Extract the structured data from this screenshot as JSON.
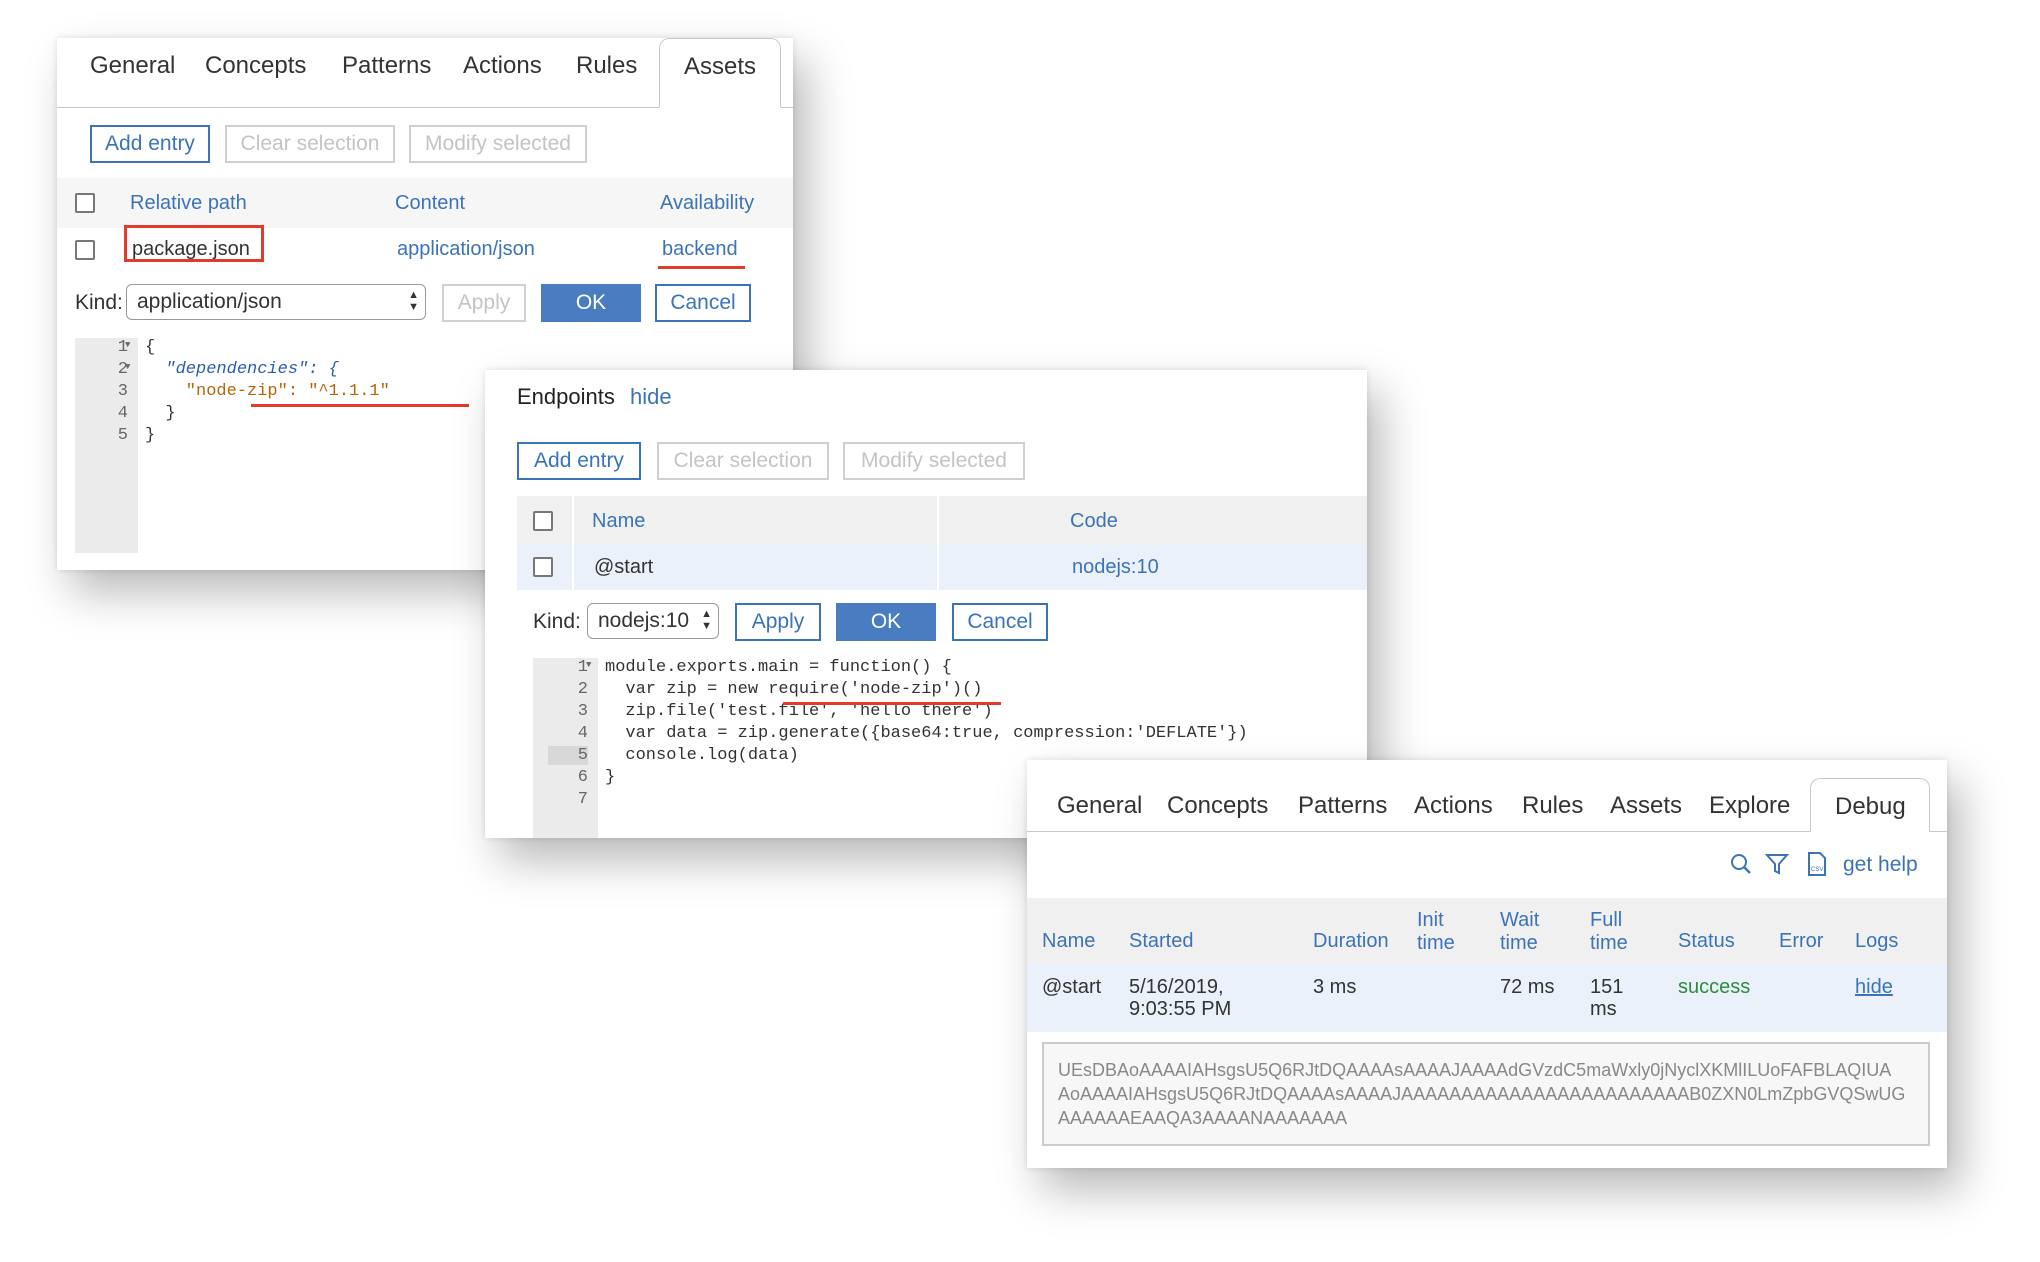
{
  "panel1": {
    "tabs": [
      "General",
      "Concepts",
      "Patterns",
      "Actions",
      "Rules",
      "Assets"
    ],
    "active_tab": "Assets",
    "buttons": {
      "add": "Add entry",
      "clear": "Clear selection",
      "modify": "Modify selected"
    },
    "headers": {
      "path": "Relative path",
      "content": "Content",
      "availability": "Availability"
    },
    "row": {
      "path": "package.json",
      "content": "application/json",
      "availability": "backend"
    },
    "kind_label": "Kind:",
    "kind_value": "application/json",
    "apply": "Apply",
    "ok": "OK",
    "cancel": "Cancel",
    "code_lines": [
      "{",
      "  \"dependencies\": {",
      "    \"node-zip\": \"^1.1.1\"",
      "  }",
      "}"
    ],
    "line_numbers": [
      "1",
      "2",
      "3",
      "4",
      "5"
    ]
  },
  "panel2": {
    "title": "Endpoints",
    "hide": "hide",
    "buttons": {
      "add": "Add entry",
      "clear": "Clear selection",
      "modify": "Modify selected"
    },
    "headers": {
      "name": "Name",
      "code": "Code"
    },
    "row": {
      "name": "@start",
      "code": "nodejs:10"
    },
    "kind_label": "Kind:",
    "kind_value": "nodejs:10",
    "apply": "Apply",
    "ok": "OK",
    "cancel": "Cancel",
    "code_lines": [
      "module.exports.main = function() {",
      "  var zip = new require('node-zip')()",
      "  zip.file('test.file', 'hello there')",
      "  var data = zip.generate({base64:true, compression:'DEFLATE'})",
      "  console.log(data)",
      "}",
      ""
    ],
    "line_numbers": [
      "1",
      "2",
      "3",
      "4",
      "5",
      "6",
      "7"
    ]
  },
  "panel3": {
    "tabs": [
      "General",
      "Concepts",
      "Patterns",
      "Actions",
      "Rules",
      "Assets",
      "Explore",
      "Debug"
    ],
    "active_tab": "Debug",
    "toolbar": {
      "search_icon": "search-icon",
      "filter_icon": "filter-icon",
      "export_icon": "csv-export-icon",
      "help": "get help"
    },
    "headers": {
      "name": "Name",
      "started": "Started",
      "duration": "Duration",
      "init_1": "Init",
      "init_2": "time",
      "wait_1": "Wait",
      "wait_2": "time",
      "full_1": "Full",
      "full_2": "time",
      "status": "Status",
      "error": "Error",
      "logs": "Logs"
    },
    "row": {
      "name": "@start",
      "started_1": "5/16/2019,",
      "started_2": "9:03:55 PM",
      "duration": "3 ms",
      "init": "",
      "wait": "72 ms",
      "full_1": "151",
      "full_2": "ms",
      "status": "success",
      "error": "",
      "logs": "hide"
    },
    "log_lines": [
      "UEsDBAoAAAAIAHsgsU5Q6RJtDQAAAAsAAAAJAAAAdGVzdC5maWxly0jNyclXKMlILUoFAFBLAQIUA",
      "AoAAAAIAHsgsU5Q6RJtDQAAAAsAAAAJAAAAAAAAAAAAAAAAAAAAAAAAB0ZXN0LmZpbGVQSwUG",
      "AAAAAAEAAQA3AAAANAAAAAAA"
    ]
  },
  "colors": {
    "accent": "#3b73b9",
    "annotation_red": "#e23b2e",
    "success": "#2e8b3a"
  }
}
